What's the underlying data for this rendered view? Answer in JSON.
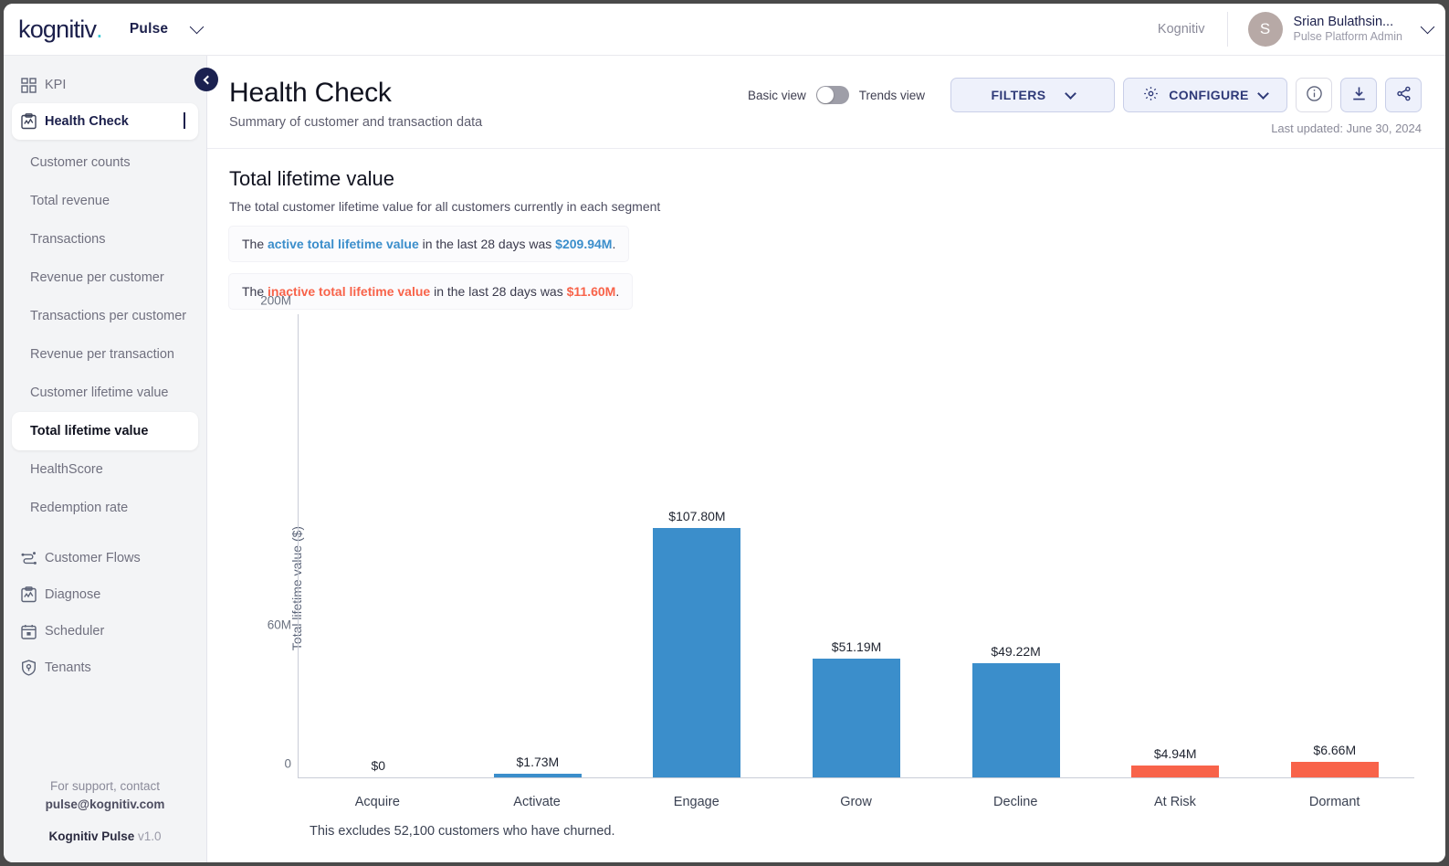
{
  "topbar": {
    "logo_text": "kognitiv",
    "product": "Pulse",
    "tenant": "Kognitiv",
    "user": {
      "initial": "S",
      "name": "Srian Bulathsin...",
      "role": "Pulse Platform Admin"
    }
  },
  "sidebar": {
    "primary": [
      {
        "label": "KPI",
        "icon": "grid-icon",
        "active": false
      },
      {
        "label": "Health Check",
        "icon": "clipboard-chart-icon",
        "active": true
      }
    ],
    "sub_items": [
      {
        "label": "Customer counts",
        "active": false
      },
      {
        "label": "Total revenue",
        "active": false
      },
      {
        "label": "Transactions",
        "active": false
      },
      {
        "label": "Revenue per customer",
        "active": false
      },
      {
        "label": "Transactions per customer",
        "active": false
      },
      {
        "label": "Revenue per transaction",
        "active": false
      },
      {
        "label": "Customer lifetime value",
        "active": false
      },
      {
        "label": "Total lifetime value",
        "active": true
      },
      {
        "label": "HealthScore",
        "active": false
      },
      {
        "label": "Redemption rate",
        "active": false
      }
    ],
    "bottom": [
      {
        "label": "Customer Flows",
        "icon": "flow-icon"
      },
      {
        "label": "Diagnose",
        "icon": "clipboard-chart-icon"
      },
      {
        "label": "Scheduler",
        "icon": "calendar-icon"
      },
      {
        "label": "Tenants",
        "icon": "shield-user-icon"
      }
    ],
    "footer": {
      "line1": "For support, contact",
      "line2": "pulse@kognitiv.com",
      "line3_bold": "Kognitiv Pulse",
      "line3_rest": "v1.0"
    }
  },
  "header": {
    "title": "Health Check",
    "subtitle": "Summary of customer and transaction data",
    "basic_view_label": "Basic view",
    "trends_view_label": "Trends view",
    "filters_label": "FILTERS",
    "configure_label": "CONFIGURE",
    "last_updated": "Last updated: June 30, 2024"
  },
  "section": {
    "title": "Total lifetime value",
    "subtitle": "The total customer lifetime value for all customers currently in each segment",
    "insights": [
      {
        "pre": "The ",
        "highlight": "active total lifetime value",
        "mid": " in the last 28 days was ",
        "value": "$209.94M",
        "post": ".",
        "color": "blue"
      },
      {
        "pre": "The ",
        "highlight": "inactive total lifetime value",
        "mid": " in the last 28 days was ",
        "value": "$11.60M",
        "post": ".",
        "color": "orange"
      }
    ]
  },
  "chart_data": {
    "type": "bar",
    "title": "Total lifetime value",
    "xlabel": "",
    "ylabel": "Total lifetime value ($)",
    "categories": [
      "Acquire",
      "Activate",
      "Engage",
      "Grow",
      "Decline",
      "At Risk",
      "Dormant"
    ],
    "values": [
      0,
      1.73,
      107.8,
      51.19,
      49.22,
      4.94,
      6.66
    ],
    "value_labels": [
      "$0",
      "$1.73M",
      "$107.80M",
      "$51.19M",
      "$49.22M",
      "$4.94M",
      "$6.66M"
    ],
    "series_colors": [
      "#3b8ecb",
      "#3b8ecb",
      "#3b8ecb",
      "#3b8ecb",
      "#3b8ecb",
      "#f8634a",
      "#f8634a"
    ],
    "ylim": [
      0,
      200
    ],
    "yticks": [
      0,
      60,
      200
    ],
    "ytick_labels": [
      "0",
      "60M",
      "200M"
    ],
    "grid": false,
    "legend": "none",
    "footnote": "This excludes 52,100 customers who have churned.",
    "units": "millions of dollars"
  },
  "colors": {
    "active_blue": "#3b8ecb",
    "inactive_orange": "#f8634a",
    "brand_navy": "#1b2150",
    "brand_teal": "#3ac9d6"
  }
}
